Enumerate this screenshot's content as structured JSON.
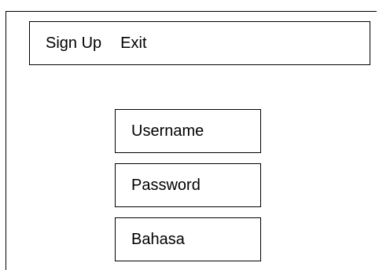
{
  "menu": {
    "items": [
      "Sign Up",
      "Exit"
    ]
  },
  "form": {
    "fields": [
      "Username",
      "Password",
      "Bahasa"
    ]
  }
}
